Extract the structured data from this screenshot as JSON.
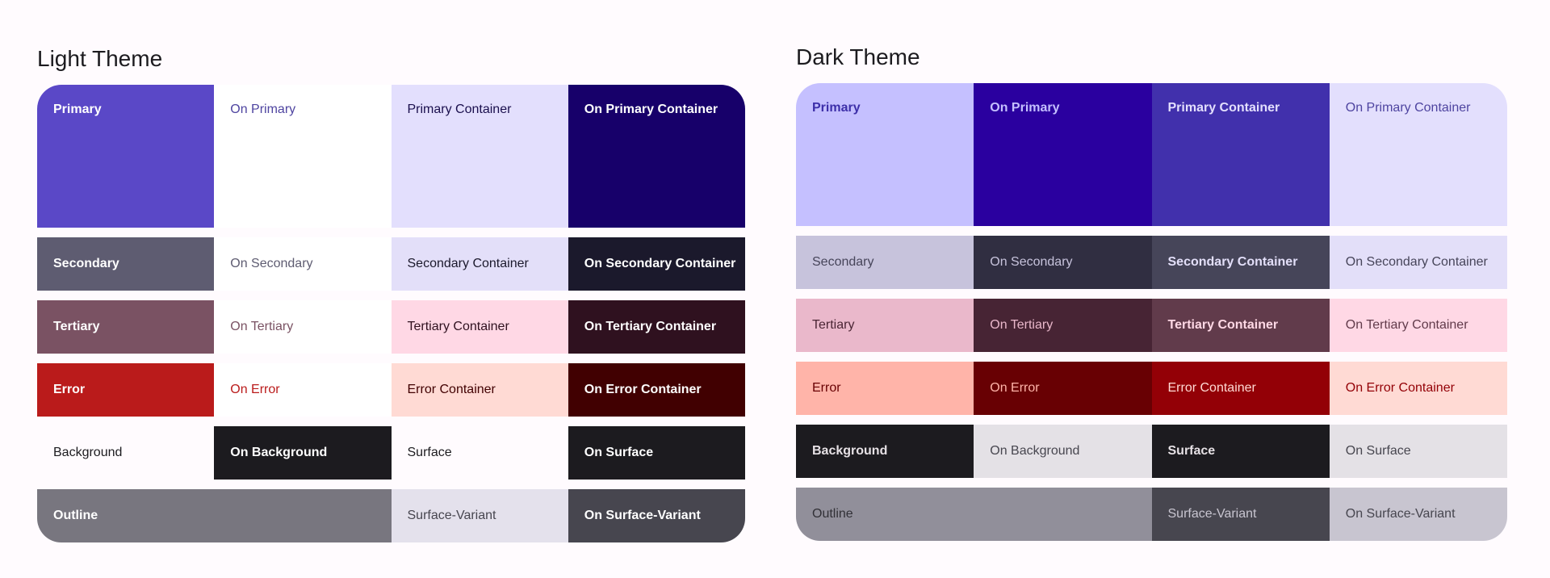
{
  "light": {
    "title": "Light Theme",
    "rows": [
      [
        {
          "label": "Primary",
          "bg": "#5a48c7",
          "fg": "#ffffff",
          "bold": true
        },
        {
          "label": "On Primary",
          "bg": "#ffffff",
          "fg": "#4e44a0",
          "bold": false
        },
        {
          "label": "Primary Container",
          "bg": "#e3dffd",
          "fg": "#1a0f4d",
          "bold": false
        },
        {
          "label": "On Primary Container",
          "bg": "#17006a",
          "fg": "#ffffff",
          "bold": true
        }
      ],
      [
        {
          "label": "Secondary",
          "bg": "#5e5c71",
          "fg": "#ffffff",
          "bold": true
        },
        {
          "label": "On Secondary",
          "bg": "#ffffff",
          "fg": "#5e5c71",
          "bold": false
        },
        {
          "label": "Secondary Container",
          "bg": "#e3dff9",
          "fg": "#1b192c",
          "bold": false
        },
        {
          "label": "On Secondary Container",
          "bg": "#1b192c",
          "fg": "#ffffff",
          "bold": true
        }
      ],
      [
        {
          "label": "Tertiary",
          "bg": "#7a5263",
          "fg": "#ffffff",
          "bold": true
        },
        {
          "label": "On Tertiary",
          "bg": "#ffffff",
          "fg": "#7a5263",
          "bold": false
        },
        {
          "label": "Tertiary Container",
          "bg": "#ffd8e5",
          "fg": "#2f111f",
          "bold": false
        },
        {
          "label": "On Tertiary Container",
          "bg": "#2f111f",
          "fg": "#ffffff",
          "bold": true
        }
      ],
      [
        {
          "label": "Error",
          "bg": "#ba1b1b",
          "fg": "#ffffff",
          "bold": true
        },
        {
          "label": "On Error",
          "bg": "#ffffff",
          "fg": "#ba1b1b",
          "bold": false
        },
        {
          "label": "Error Container",
          "bg": "#ffdad4",
          "fg": "#410001",
          "bold": false
        },
        {
          "label": "On Error Container",
          "bg": "#410001",
          "fg": "#ffffff",
          "bold": true
        }
      ],
      [
        {
          "label": "Background",
          "bg": "#fffbfe",
          "fg": "#1c1b1f",
          "bold": false
        },
        {
          "label": "On Background",
          "bg": "#1c1b1f",
          "fg": "#ffffff",
          "bold": true
        },
        {
          "label": "Surface",
          "bg": "#fffbfe",
          "fg": "#1c1b1f",
          "bold": false
        },
        {
          "label": "On Surface",
          "bg": "#1c1b1f",
          "fg": "#ffffff",
          "bold": true
        }
      ],
      [
        {
          "label": "Outline",
          "bg": "#78767f",
          "fg": "#ffffff",
          "bold": true,
          "span": 2
        },
        {
          "label": "Surface-Variant",
          "bg": "#e4e1ec",
          "fg": "#47464f",
          "bold": false
        },
        {
          "label": "On Surface-Variant",
          "bg": "#47464f",
          "fg": "#ffffff",
          "bold": true
        }
      ]
    ]
  },
  "dark": {
    "title": "Dark Theme",
    "rows": [
      [
        {
          "label": "Primary",
          "bg": "#c5c0ff",
          "fg": "#3d2fa9",
          "bold": true
        },
        {
          "label": "On Primary",
          "bg": "#2a009f",
          "fg": "#c5c0ff",
          "bold": true
        },
        {
          "label": "Primary Container",
          "bg": "#4130ac",
          "fg": "#e3dffd",
          "bold": true
        },
        {
          "label": "On Primary Container",
          "bg": "#e3dffd",
          "fg": "#4e44a0",
          "bold": false
        }
      ],
      [
        {
          "label": "Secondary",
          "bg": "#c7c3dc",
          "fg": "#47455a",
          "bold": false
        },
        {
          "label": "On Secondary",
          "bg": "#302e41",
          "fg": "#c7c3dc",
          "bold": false
        },
        {
          "label": "Secondary Container",
          "bg": "#464559",
          "fg": "#e3dff9",
          "bold": true
        },
        {
          "label": "On Secondary Container",
          "bg": "#e3dff9",
          "fg": "#47455a",
          "bold": false
        }
      ],
      [
        {
          "label": "Tertiary",
          "bg": "#eab8cb",
          "fg": "#4a2534",
          "bold": false
        },
        {
          "label": "On Tertiary",
          "bg": "#472434",
          "fg": "#eab8cb",
          "bold": false
        },
        {
          "label": "Tertiary Container",
          "bg": "#613b4b",
          "fg": "#ffd8e5",
          "bold": true
        },
        {
          "label": "On Tertiary Container",
          "bg": "#ffd8e5",
          "fg": "#613b4b",
          "bold": false
        }
      ],
      [
        {
          "label": "Error",
          "bg": "#ffb4a9",
          "fg": "#680003",
          "bold": false
        },
        {
          "label": "On Error",
          "bg": "#680003",
          "fg": "#ffb4a9",
          "bold": false
        },
        {
          "label": "Error Container",
          "bg": "#930006",
          "fg": "#ffdad4",
          "bold": false
        },
        {
          "label": "On Error Container",
          "bg": "#ffdad4",
          "fg": "#930006",
          "bold": false
        }
      ],
      [
        {
          "label": "Background",
          "bg": "#1c1b1f",
          "fg": "#e6e1e5",
          "bold": true
        },
        {
          "label": "On Background",
          "bg": "#e4e1e6",
          "fg": "#47464f",
          "bold": false
        },
        {
          "label": "Surface",
          "bg": "#1c1b1f",
          "fg": "#e6e1e5",
          "bold": true
        },
        {
          "label": "On Surface",
          "bg": "#e4e1e6",
          "fg": "#47464f",
          "bold": false
        }
      ],
      [
        {
          "label": "Outline",
          "bg": "#918f9a",
          "fg": "#313036",
          "bold": false,
          "span": 2
        },
        {
          "label": "Surface-Variant",
          "bg": "#47464f",
          "fg": "#c8c5d0",
          "bold": false
        },
        {
          "label": "On Surface-Variant",
          "bg": "#c8c5d0",
          "fg": "#47464f",
          "bold": false
        }
      ]
    ]
  }
}
